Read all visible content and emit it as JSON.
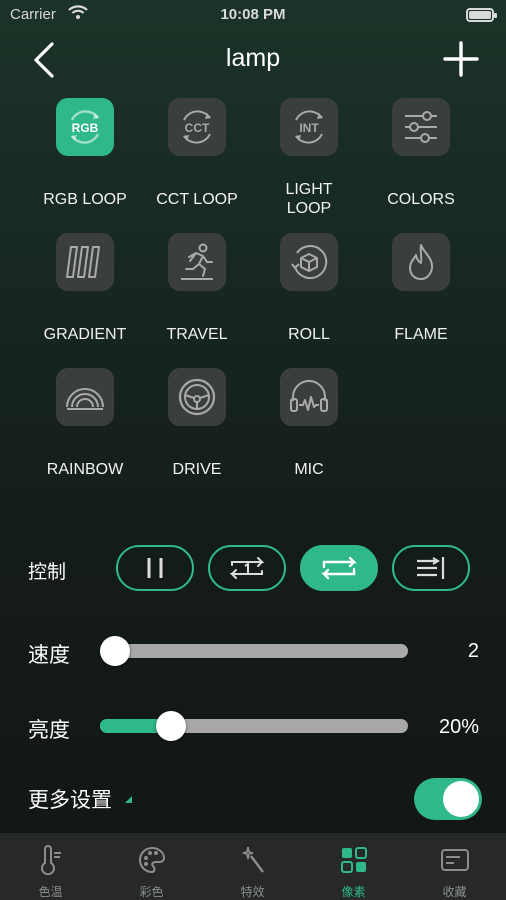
{
  "status_bar": {
    "carrier": "Carrier",
    "time": "10:08 PM"
  },
  "header": {
    "title": "lamp",
    "back_icon": "chevron-left-icon",
    "add_icon": "plus-icon"
  },
  "effects": [
    {
      "label": "RGB LOOP",
      "icon": "rgb-loop-icon",
      "badge": "RGB",
      "active": true
    },
    {
      "label": "CCT LOOP",
      "icon": "cct-loop-icon",
      "badge": "CCT",
      "active": false
    },
    {
      "label": "LIGHT\nLOOP",
      "icon": "int-loop-icon",
      "badge": "INT",
      "active": false
    },
    {
      "label": "COLORS",
      "icon": "sliders-icon",
      "active": false
    },
    {
      "label": "GRADIENT",
      "icon": "gradient-bars-icon",
      "active": false
    },
    {
      "label": "TRAVEL",
      "icon": "running-person-icon",
      "active": false
    },
    {
      "label": "ROLL",
      "icon": "roll-cube-icon",
      "active": false
    },
    {
      "label": "FLAME",
      "icon": "flame-icon",
      "active": false
    },
    {
      "label": "RAINBOW",
      "icon": "rainbow-icon",
      "active": false
    },
    {
      "label": "DRIVE",
      "icon": "steering-wheel-icon",
      "active": false
    },
    {
      "label": "MIC",
      "icon": "headphones-mic-icon",
      "active": false
    }
  ],
  "controls": {
    "label": "控制",
    "buttons": [
      {
        "name": "pause",
        "icon": "pause-icon",
        "active": false
      },
      {
        "name": "repeat-one",
        "icon": "repeat-one-icon",
        "active": false
      },
      {
        "name": "repeat-all",
        "icon": "repeat-icon",
        "active": true
      },
      {
        "name": "sequence",
        "icon": "list-order-icon",
        "active": false
      }
    ]
  },
  "speed": {
    "label": "速度",
    "value": "2",
    "fraction": 0.05
  },
  "brightness": {
    "label": "亮度",
    "value": "20%",
    "fraction": 0.23
  },
  "more_settings": {
    "label": "更多设置",
    "enabled": true
  },
  "tabs": [
    {
      "label": "色温",
      "icon": "thermometer-icon",
      "active": false
    },
    {
      "label": "彩色",
      "icon": "palette-icon",
      "active": false
    },
    {
      "label": "特效",
      "icon": "magic-wand-icon",
      "active": false
    },
    {
      "label": "像素",
      "icon": "grid-squares-icon",
      "active": true
    },
    {
      "label": "收藏",
      "icon": "card-icon",
      "active": false
    }
  ],
  "colors": {
    "accent": "#2fb889",
    "tile": "#3a3f3d",
    "tabbar": "#262928",
    "inactive_tab": "#8b8e8d"
  }
}
